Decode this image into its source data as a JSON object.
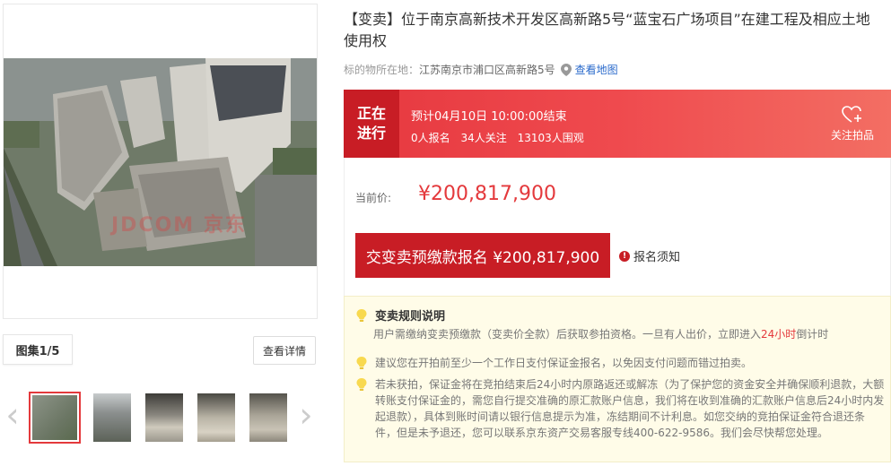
{
  "gallery": {
    "watermark": "JDCOM 京东",
    "album_label": "图集1/5",
    "detail_button": "查看详情",
    "thumbs": [
      "thumb-1",
      "thumb-2",
      "thumb-3",
      "thumb-4",
      "thumb-5"
    ]
  },
  "item": {
    "title": "【变卖】位于南京高新技术开发区高新路5号“蓝宝石广场项目”在建工程及相应土地使用权",
    "location_label": "标的物所在地：",
    "location_value": "江苏南京市浦口区高新路5号",
    "map_link": "查看地图"
  },
  "status": {
    "line1": "正在",
    "line2": "进行",
    "end_time": "预计04月10日 10:00:00结束",
    "signup": "0人报名",
    "follow_count": "34人关注",
    "viewers": "13103人围观",
    "follow_label": "关注拍品"
  },
  "price": {
    "label": "当前价:",
    "value": "¥200,817,900",
    "apply_button": "交变卖预缴款报名 ¥200,817,900",
    "notice": "报名须知"
  },
  "rules": {
    "title": "变卖规则说明",
    "line1_pre": "用户需缴纳变卖预缴款（变卖价全款）后获取参拍资格。一旦有人出价，立即进入",
    "line1_hl": "24小时",
    "line1_post": "倒计时",
    "line2": "建议您在开拍前至少一个工作日支付保证金报名，以免因支付问题而错过拍卖。",
    "line3": "若未获拍，保证金将在竞拍结束后24小时内原路返还或解冻（为了保护您的资金安全并确保顺利退款，大额转账支付保证金的，需您自行提交准确的原汇款账户信息，我们将在收到准确的汇款账户信息后24小时内发起退款），具体到账时间请以银行信息提示为准，冻结期间不计利息。如您交纳的竞拍保证金符合退还条件，但是未予退还，您可以联系京东资产交易客服专线400-622-9586。我们会尽快帮您处理。"
  },
  "colors": {
    "accent": "#e4393c",
    "dark_red": "#c81d25",
    "map_link": "#2a6acb",
    "rules_bg": "#fffce8"
  }
}
